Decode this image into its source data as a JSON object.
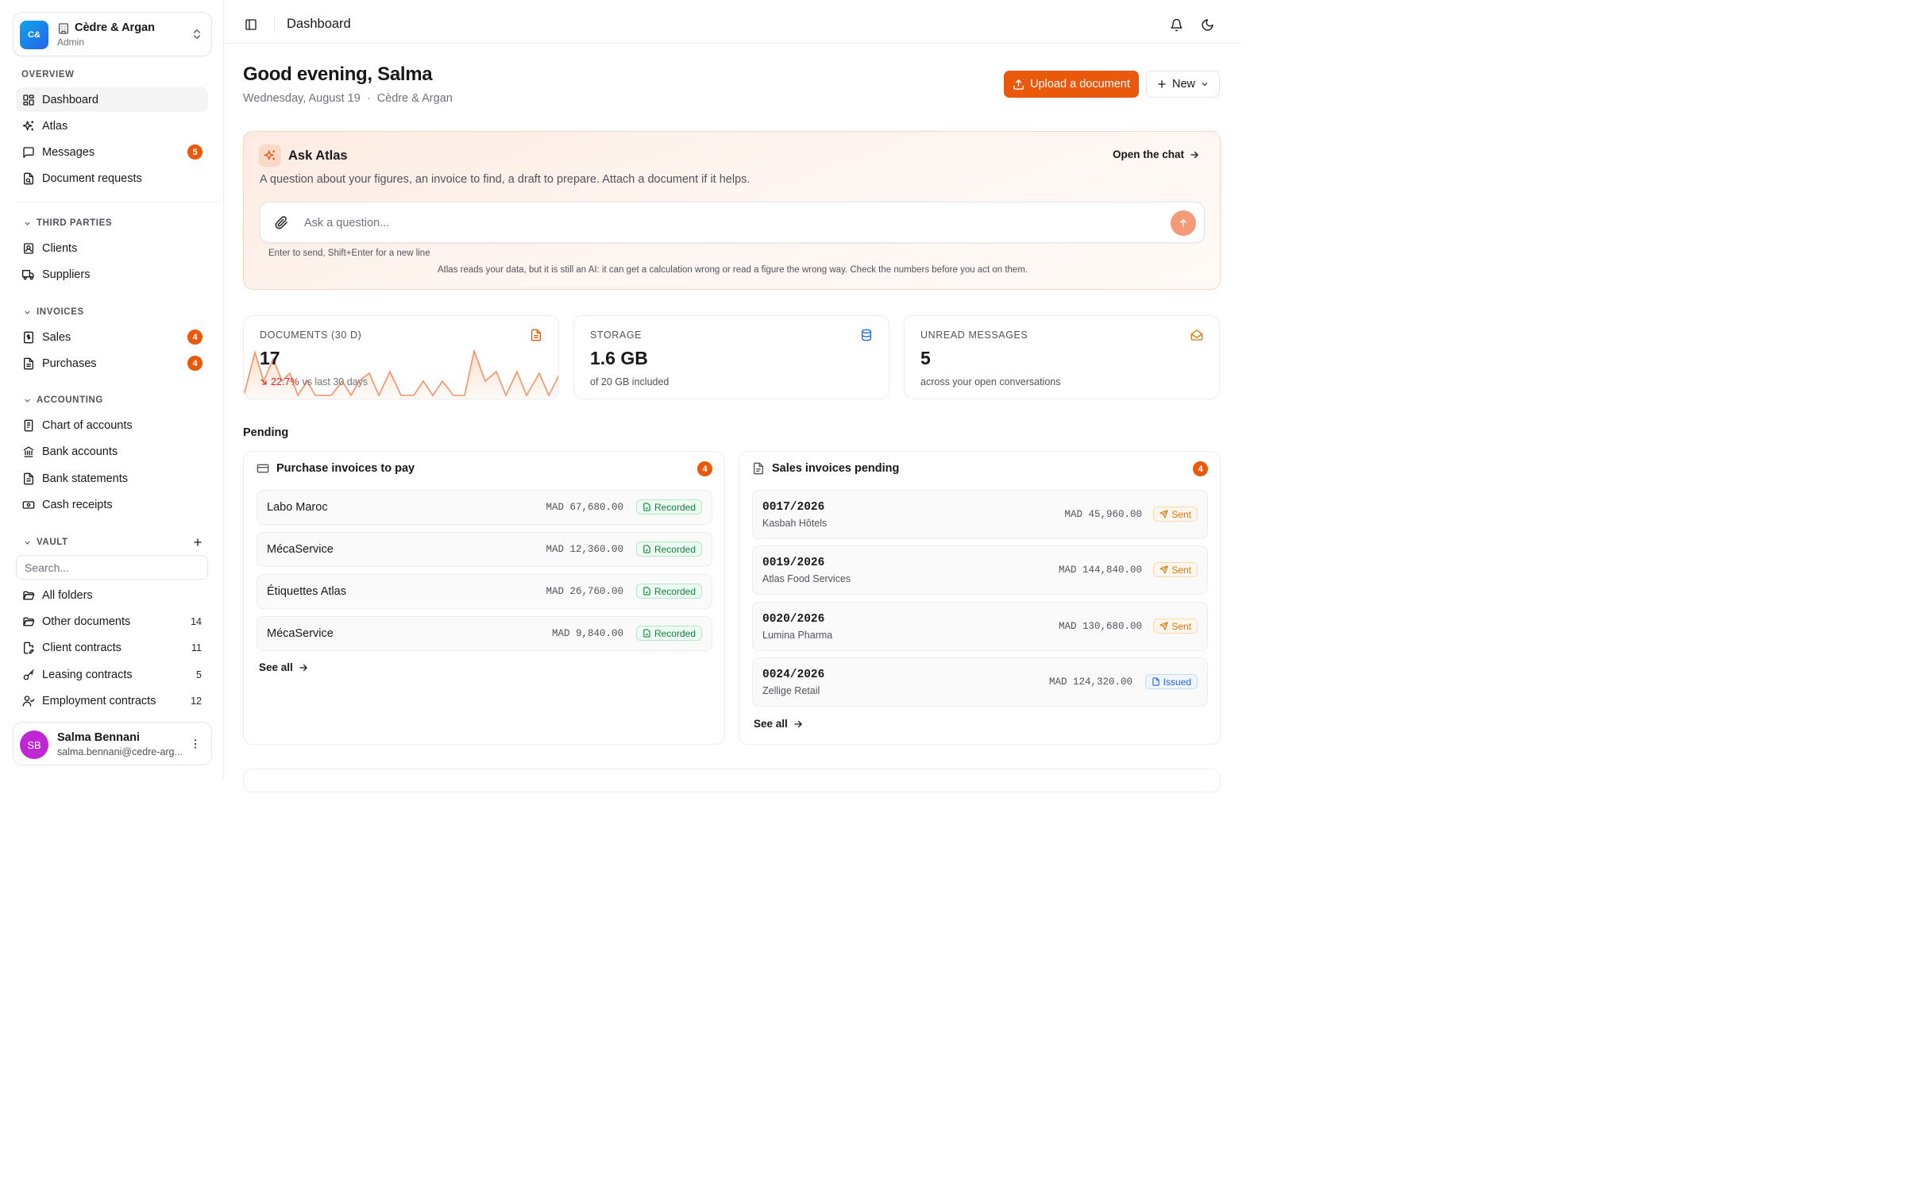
{
  "org": {
    "logo_text": "C&",
    "name": "Cèdre & Argan",
    "role": "Admin"
  },
  "sidebar": {
    "overview_label": "OVERVIEW",
    "overview": [
      {
        "label": "Dashboard",
        "icon": "dashboard-icon",
        "active": true
      },
      {
        "label": "Atlas",
        "icon": "sparkles-icon"
      },
      {
        "label": "Messages",
        "icon": "message-icon",
        "badge": "5"
      },
      {
        "label": "Document requests",
        "icon": "document-request-icon"
      }
    ],
    "third_parties_label": "THIRD PARTIES",
    "third_parties": [
      {
        "label": "Clients",
        "icon": "contact-icon"
      },
      {
        "label": "Suppliers",
        "icon": "truck-icon"
      }
    ],
    "invoices_label": "INVOICES",
    "invoices": [
      {
        "label": "Sales",
        "icon": "receipt-icon",
        "badge": "4"
      },
      {
        "label": "Purchases",
        "icon": "file-icon",
        "badge": "4"
      }
    ],
    "accounting_label": "ACCOUNTING",
    "accounting": [
      {
        "label": "Chart of accounts",
        "icon": "book-icon"
      },
      {
        "label": "Bank accounts",
        "icon": "bank-icon"
      },
      {
        "label": "Bank statements",
        "icon": "statement-icon"
      },
      {
        "label": "Cash receipts",
        "icon": "cash-icon"
      }
    ],
    "vault_label": "VAULT",
    "vault_search_placeholder": "Search...",
    "vault": [
      {
        "label": "All folders",
        "icon": "folder-open-icon"
      },
      {
        "label": "Other documents",
        "icon": "folder-open-icon",
        "count": "14"
      },
      {
        "label": "Client contracts",
        "icon": "contract-icon",
        "count": "11"
      },
      {
        "label": "Leasing contracts",
        "icon": "key-icon",
        "count": "5"
      },
      {
        "label": "Employment contracts",
        "icon": "user-check-icon",
        "count": "12"
      }
    ]
  },
  "user": {
    "initials": "SB",
    "name": "Salma Bennani",
    "email": "salma.bennani@cedre-arg..."
  },
  "topbar": {
    "title": "Dashboard"
  },
  "header": {
    "greeting": "Good evening, Salma",
    "date": "Wednesday, August 19",
    "separator": "·",
    "org": "Cèdre & Argan",
    "upload_label": "Upload a document",
    "new_label": "New"
  },
  "atlas": {
    "title": "Ask Atlas",
    "open_chat": "Open the chat",
    "description": "A question about your figures, an invoice to find, a draft to prepare. Attach a document if it helps.",
    "placeholder": "Ask a question...",
    "hint": "Enter to send, Shift+Enter for a new line",
    "disclaimer": "Atlas reads your data, but it is still an AI: it can get a calculation wrong or read a figure the wrong way. Check the numbers before you act on them."
  },
  "stats": {
    "documents": {
      "label": "DOCUMENTS (30 D)",
      "value": "17",
      "trend_pct": "22.7%",
      "trend_text": "vs last 30 days"
    },
    "storage": {
      "label": "STORAGE",
      "value": "1.6 GB",
      "sub": "of 20 GB included"
    },
    "unread": {
      "label": "UNREAD MESSAGES",
      "value": "5",
      "sub": "across your open conversations"
    }
  },
  "colors": {
    "accent": "#ea580c",
    "recorded": "#15803d",
    "sent": "#d97706",
    "issued": "#2563eb"
  },
  "pending": {
    "title": "Pending",
    "purchases": {
      "title": "Purchase invoices to pay",
      "badge": "4",
      "see_all": "See all",
      "rows": [
        {
          "name": "Labo Maroc",
          "amount": "MAD 67,680.00",
          "status": "Recorded"
        },
        {
          "name": "MécaService",
          "amount": "MAD 12,360.00",
          "status": "Recorded"
        },
        {
          "name": "Étiquettes Atlas",
          "amount": "MAD 26,760.00",
          "status": "Recorded"
        },
        {
          "name": "MécaService",
          "amount": "MAD 9,840.00",
          "status": "Recorded"
        }
      ]
    },
    "sales": {
      "title": "Sales invoices pending",
      "badge": "4",
      "see_all": "See all",
      "rows": [
        {
          "number": "0017/2026",
          "client": "Kasbah Hôtels",
          "amount": "MAD 45,960.00",
          "status": "Sent"
        },
        {
          "number": "0019/2026",
          "client": "Atlas Food Services",
          "amount": "MAD 144,840.00",
          "status": "Sent"
        },
        {
          "number": "0020/2026",
          "client": "Lumina Pharma",
          "amount": "MAD 130,680.00",
          "status": "Sent"
        },
        {
          "number": "0024/2026",
          "client": "Zellige Retail",
          "amount": "MAD 124,320.00",
          "status": "Issued"
        }
      ]
    }
  }
}
